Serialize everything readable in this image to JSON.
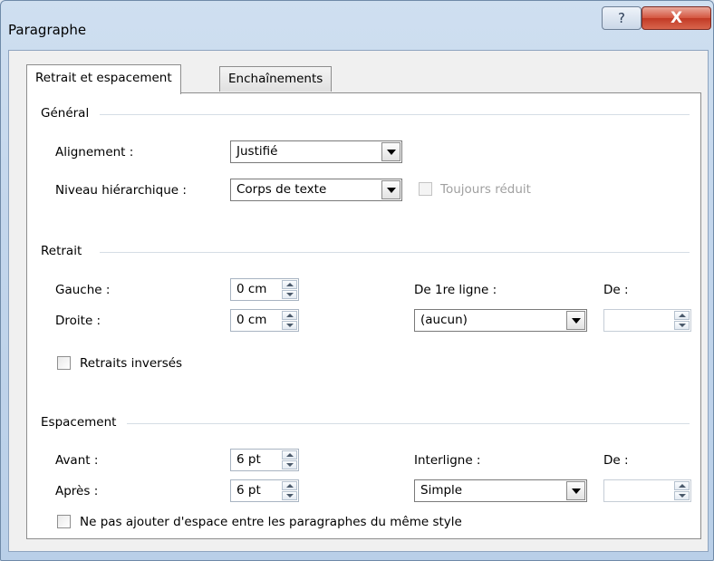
{
  "window": {
    "title": "Paragraphe",
    "help_icon": "?",
    "close_icon": "X"
  },
  "tabs": [
    {
      "label": "Retrait et espacement",
      "active": true
    },
    {
      "label": "Enchaînements",
      "active": false
    }
  ],
  "general": {
    "title": "Général",
    "alignment": {
      "label": "Alignement :",
      "value": "Justifié"
    },
    "outline_level": {
      "label": "Niveau hiérarchique :",
      "value": "Corps de texte"
    },
    "collapsed": {
      "label": "Toujours réduit",
      "checked": false,
      "enabled": false
    }
  },
  "indent": {
    "title": "Retrait",
    "left": {
      "label": "Gauche :",
      "value": "0 cm"
    },
    "right": {
      "label": "Droite :",
      "value": "0 cm"
    },
    "special": {
      "label": "De 1re ligne :",
      "value": "(aucun)"
    },
    "by": {
      "label": "De :",
      "value": ""
    },
    "mirror": {
      "label": "Retraits inversés",
      "checked": false
    }
  },
  "spacing": {
    "title": "Espacement",
    "before": {
      "label": "Avant :",
      "value": "6 pt"
    },
    "after": {
      "label": "Après :",
      "value": "6 pt"
    },
    "line_spacing": {
      "label": "Interligne :",
      "value": "Simple"
    },
    "at": {
      "label": "De :",
      "value": ""
    },
    "no_space_same_style": {
      "label": "Ne pas ajouter d'espace entre les paragraphes du même style",
      "checked": false
    }
  },
  "colors": {
    "close_red": "#c23a25",
    "frame_blue": "#c3d6ec"
  }
}
